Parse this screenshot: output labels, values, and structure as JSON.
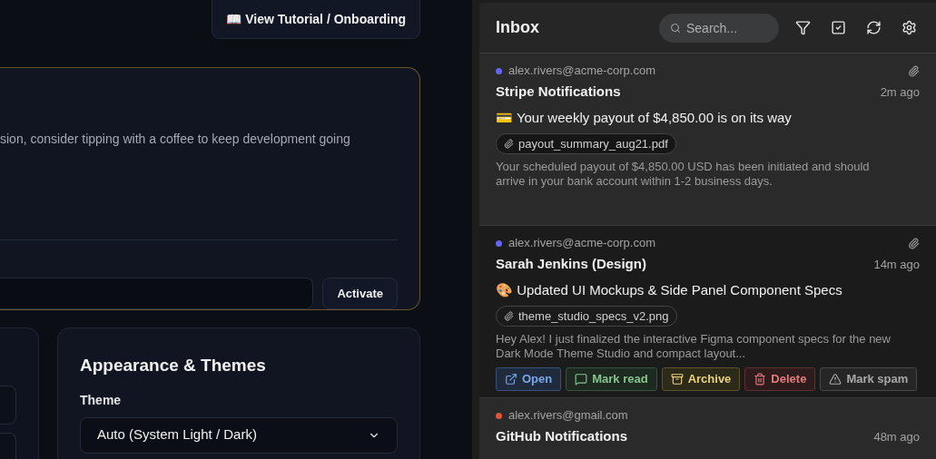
{
  "tutorial_button": {
    "label": "📖 View Tutorial / Onboarding"
  },
  "support_card": {
    "text": "sion, consider tipping with a coffee to keep development going",
    "activate_button": "Activate"
  },
  "appearance_card": {
    "title": "Appearance & Themes",
    "theme_label": "Theme",
    "theme_value": "Auto (System Light / Dark)"
  },
  "inbox": {
    "title": "Inbox",
    "search_placeholder": "Search...",
    "emails": [
      {
        "account": "alex.rivers@acme-corp.com",
        "color": "#6366f1",
        "sender": "Stripe Notifications",
        "time": "2m ago",
        "subject": "💳 Your weekly payout of $4,850.00 is on its way",
        "attachment": "payout_summary_aug21.pdf",
        "preview": "Your scheduled payout of $4,850.00 USD has been initiated and should arrive in your bank account within 1-2 business days.",
        "has_attachment": true,
        "selected": false
      },
      {
        "account": "alex.rivers@acme-corp.com",
        "color": "#6366f1",
        "sender": "Sarah Jenkins (Design)",
        "time": "14m ago",
        "subject": "🎨 Updated UI Mockups & Side Panel Component Specs",
        "attachment": "theme_studio_specs_v2.png",
        "preview": "Hey Alex! I just finalized the interactive Figma component specs for the new Dark Mode Theme Studio and compact layout...",
        "has_attachment": true,
        "selected": true
      },
      {
        "account": "alex.rivers@gmail.com",
        "color": "#e0533d",
        "sender": "GitHub Notifications",
        "time": "48m ago",
        "has_attachment": false,
        "selected": false
      }
    ],
    "actions": [
      {
        "kind": "open",
        "label": "Open"
      },
      {
        "kind": "read",
        "label": "Mark read"
      },
      {
        "kind": "archive",
        "label": "Archive"
      },
      {
        "kind": "delete",
        "label": "Delete"
      },
      {
        "kind": "spam",
        "label": "Mark spam"
      }
    ]
  }
}
